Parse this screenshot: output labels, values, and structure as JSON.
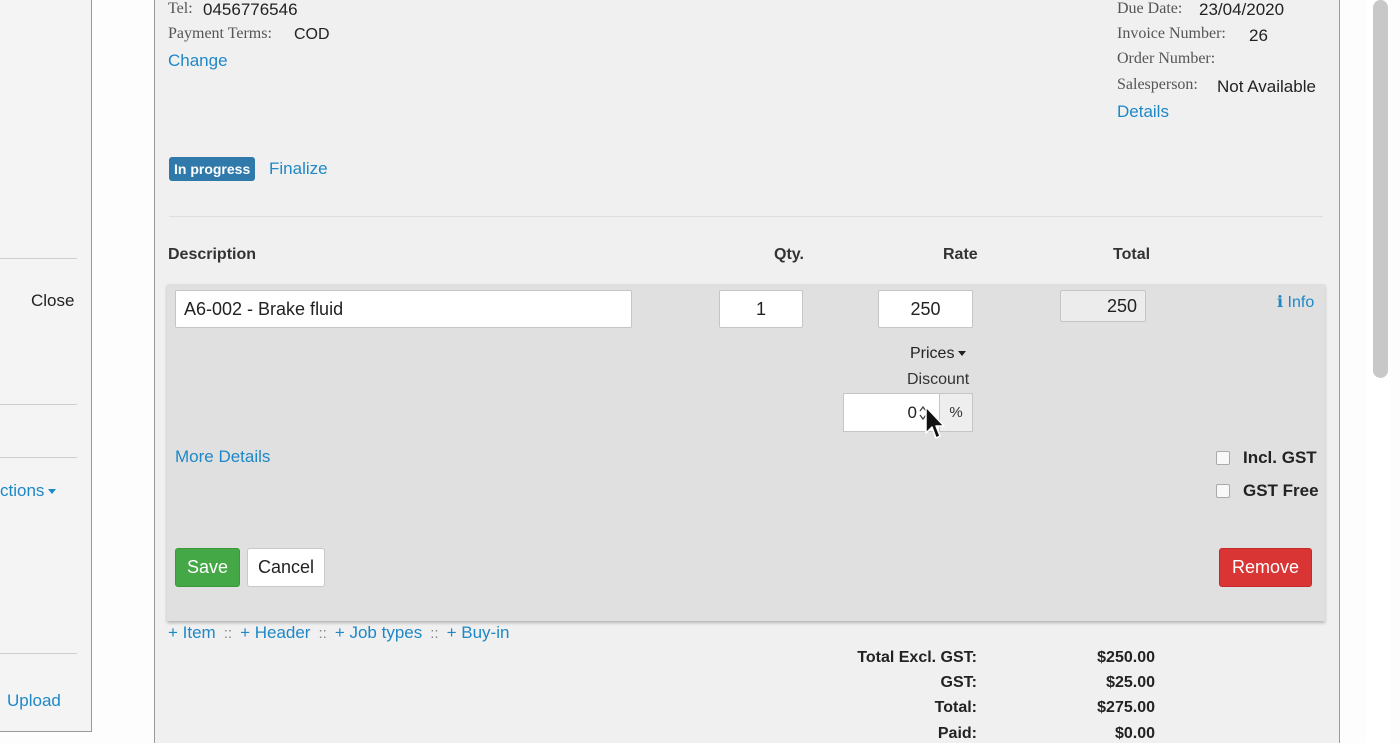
{
  "left_panel": {
    "close_label": "Close",
    "actions_label": "ctions",
    "upload_label": "Upload"
  },
  "customer": {
    "tel_label": "Tel:",
    "tel_value": "0456776546",
    "payment_terms_label": "Payment Terms:",
    "payment_terms_value": "COD",
    "change_link": "Change"
  },
  "invoice_meta": {
    "due_date_label": "Due Date:",
    "due_date_value": "23/04/2020",
    "invoice_number_label": "Invoice Number:",
    "invoice_number_value": "26",
    "order_number_label": "Order Number:",
    "salesperson_label": "Salesperson:",
    "salesperson_value": "Not Available",
    "details_link": "Details"
  },
  "status": {
    "badge": "In progress",
    "finalize_link": "Finalize"
  },
  "table_headers": {
    "description": "Description",
    "qty": "Qty.",
    "rate": "Rate",
    "total": "Total"
  },
  "line_item": {
    "description": "A6-002 - Brake fluid",
    "qty": "1",
    "rate": "250",
    "total": "250",
    "info_link": "Info",
    "prices_label": "Prices",
    "discount_label": "Discount",
    "discount_value": "0",
    "discount_unit": "%",
    "more_details_link": "More Details",
    "incl_gst_label": "Incl. GST",
    "gst_free_label": "GST Free",
    "save_button": "Save",
    "cancel_button": "Cancel",
    "remove_button": "Remove"
  },
  "add_links": {
    "item": "+ Item",
    "header": "+ Header",
    "job_types": "+ Job types",
    "buy_in": "+ Buy-in",
    "separator": "::"
  },
  "totals": {
    "excl_gst_label": "Total Excl. GST:",
    "excl_gst_value": "$250.00",
    "gst_label": "GST:",
    "gst_value": "$25.00",
    "total_label": "Total:",
    "total_value": "$275.00",
    "paid_label": "Paid:",
    "paid_value": "$0.00"
  },
  "colors": {
    "link": "#1e88c7",
    "badge": "#2f7aab",
    "save": "#45a846",
    "remove": "#d93535"
  }
}
